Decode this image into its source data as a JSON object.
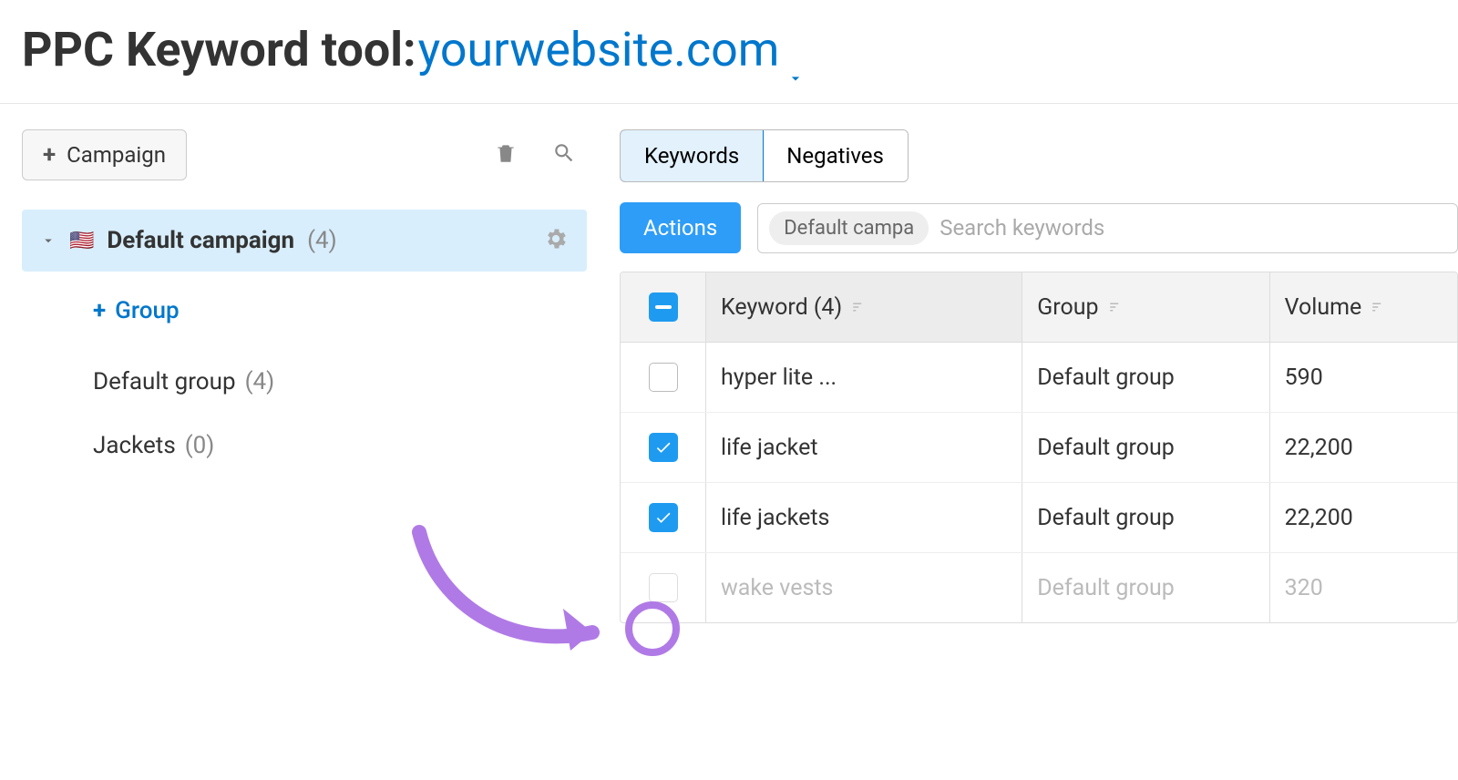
{
  "header": {
    "title_prefix": "PPC Keyword tool:",
    "domain": "yourwebsite.com"
  },
  "left": {
    "campaign_button": "Campaign",
    "campaign": {
      "flag": "🇺🇸",
      "name": "Default campaign",
      "count": "(4)"
    },
    "add_group": "Group",
    "groups": [
      {
        "name": "Default group",
        "count": "(4)"
      },
      {
        "name": "Jackets",
        "count": "(0)"
      }
    ]
  },
  "right": {
    "tabs": [
      {
        "label": "Keywords",
        "active": true
      },
      {
        "label": "Negatives",
        "active": false
      }
    ],
    "actions_button": "Actions",
    "filter_chip": "Default campa",
    "search_placeholder": "Search keywords",
    "columns": {
      "keyword": "Keyword (4)",
      "group": "Group",
      "volume": "Volume"
    },
    "rows": [
      {
        "checked": false,
        "keyword": "hyper lite ...",
        "group": "Default group",
        "volume": "590",
        "faded": false
      },
      {
        "checked": true,
        "keyword": "life jacket",
        "group": "Default group",
        "volume": "22,200",
        "faded": false,
        "highlighted": true
      },
      {
        "checked": true,
        "keyword": "life jackets",
        "group": "Default group",
        "volume": "22,200",
        "faded": false
      },
      {
        "checked": false,
        "keyword": "wake vests",
        "group": "Default group",
        "volume": "320",
        "faded": true
      }
    ]
  }
}
